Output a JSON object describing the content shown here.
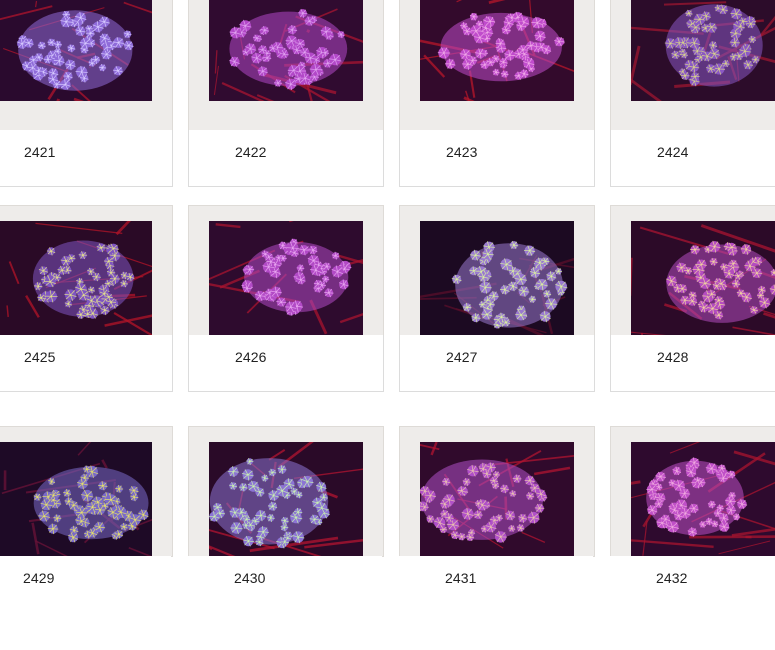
{
  "gallery": {
    "items": [
      {
        "label": "2421",
        "thumbnail": "coral-photo",
        "colors": {
          "bg": "#2a0a2e",
          "net": "#b0142c",
          "polyp": "#8f6bd9",
          "tip": "#d6c8ff"
        }
      },
      {
        "label": "2422",
        "thumbnail": "coral-photo",
        "colors": {
          "bg": "#300b30",
          "net": "#a81530",
          "polyp": "#b248c8",
          "tip": "#e0a0f0"
        }
      },
      {
        "label": "2423",
        "thumbnail": "coral-photo",
        "colors": {
          "bg": "#330a2c",
          "net": "#b8162a",
          "polyp": "#c04ccc",
          "tip": "#f0a8e8"
        }
      },
      {
        "label": "2424",
        "thumbnail": "coral-photo",
        "colors": {
          "bg": "#2c0c2a",
          "net": "#9c1630",
          "polyp": "#8a58c4",
          "tip": "#d8d48a"
        }
      },
      {
        "label": "2425",
        "thumbnail": "coral-photo",
        "colors": {
          "bg": "#2a0a26",
          "net": "#b21428",
          "polyp": "#7f55c2",
          "tip": "#e2e08c"
        }
      },
      {
        "label": "2426",
        "thumbnail": "coral-photo",
        "colors": {
          "bg": "#2e0b2e",
          "net": "#a8142e",
          "polyp": "#b24ac6",
          "tip": "#e8a4f0"
        }
      },
      {
        "label": "2427",
        "thumbnail": "coral-photo",
        "colors": {
          "bg": "#1c0a22",
          "net": "#5a0f2a",
          "polyp": "#9a7ad0",
          "tip": "#d9f0a0"
        }
      },
      {
        "label": "2428",
        "thumbnail": "coral-photo",
        "colors": {
          "bg": "#2c0a28",
          "net": "#a81430",
          "polyp": "#b44cc0",
          "tip": "#f0d0a0"
        }
      },
      {
        "label": "2429",
        "thumbnail": "coral-photo",
        "colors": {
          "bg": "#1e0a26",
          "net": "#6a1238",
          "polyp": "#7a6ac8",
          "tip": "#e4e06a"
        }
      },
      {
        "label": "2430",
        "thumbnail": "coral-photo",
        "colors": {
          "bg": "#2a0a28",
          "net": "#b21430",
          "polyp": "#8c74d4",
          "tip": "#c8f0b0"
        }
      },
      {
        "label": "2431",
        "thumbnail": "coral-photo",
        "colors": {
          "bg": "#300a2c",
          "net": "#b01430",
          "polyp": "#b050c8",
          "tip": "#e8c0b0"
        }
      },
      {
        "label": "2432",
        "thumbnail": "coral-photo",
        "colors": {
          "bg": "#2e0a2e",
          "net": "#a8142e",
          "polyp": "#c050c8",
          "tip": "#f0a8e0"
        }
      }
    ]
  }
}
